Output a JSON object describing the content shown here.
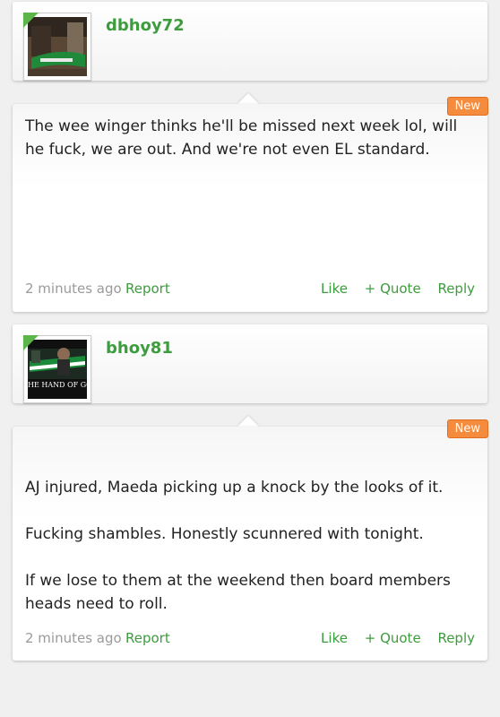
{
  "posts": [
    {
      "username": "dbhoy72",
      "badge": "New",
      "paragraphs": [
        "The wee winger thinks he'll be missed next week lol, will he fuck, we are out. And we're not even EL standard."
      ],
      "time": "2 minutes ago",
      "report": "Report",
      "like": "Like",
      "quote": "+ Quote",
      "reply": "Reply"
    },
    {
      "username": "bhoy81",
      "avatar_caption": "HE HAND OF GOD",
      "badge": "New",
      "paragraphs": [
        "AJ injured, Maeda picking up a knock by the looks of it.",
        "Fucking shambles. Honestly scunnered with tonight.",
        "If we lose to them at the weekend then board members heads need to roll."
      ],
      "time": "2 minutes ago",
      "report": "Report",
      "like": "Like",
      "quote": "+ Quote",
      "reply": "Reply"
    }
  ],
  "colors": {
    "accent": "#3d9c3d",
    "badge": "#f58b3c",
    "muted": "#9a9a9a"
  }
}
